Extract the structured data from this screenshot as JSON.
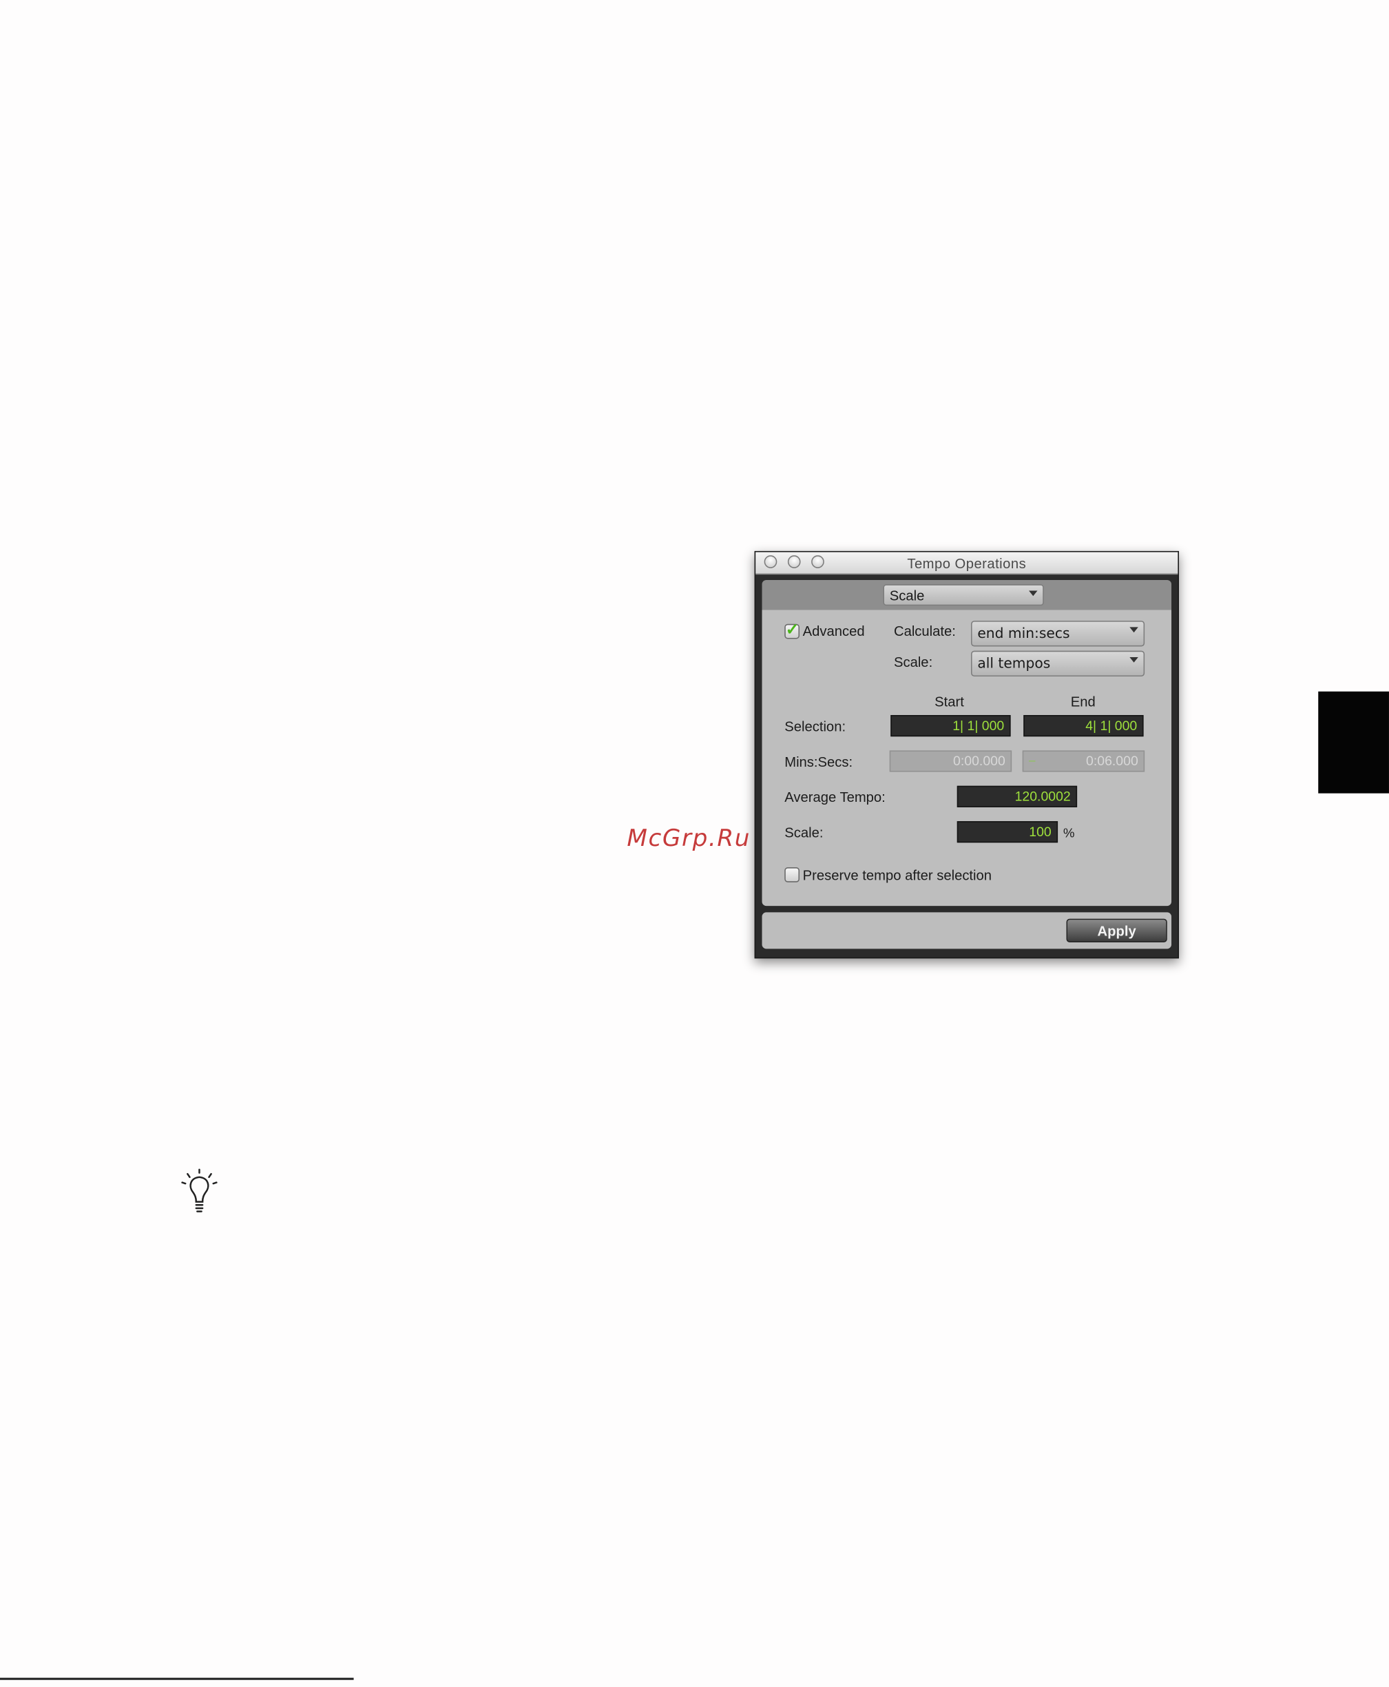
{
  "window": {
    "title": "Tempo Operations",
    "operation_popup": "Scale",
    "advanced_label": "Advanced",
    "advanced_checked": true,
    "calculate_label": "Calculate:",
    "calculate_value": "end min:secs",
    "scale_mode_label": "Scale:",
    "scale_mode_value": "all tempos",
    "col_start": "Start",
    "col_end": "End",
    "selection_label": "Selection:",
    "selection_start": "1| 1| 000",
    "selection_end": "4| 1| 000",
    "minssecs_label": "Mins:Secs:",
    "minssecs_start": "0:00.000",
    "minssecs_end": "0:06.000",
    "avg_tempo_label": "Average Tempo:",
    "avg_tempo_value": "120.0002",
    "scale_label": "Scale:",
    "scale_value": "100",
    "scale_unit": "%",
    "preserve_label": "Preserve tempo after selection",
    "preserve_checked": false,
    "apply_label": "Apply"
  },
  "watermark": "McGrp.Ru",
  "icons": {
    "tip": "lightbulb-icon"
  },
  "colors": {
    "field_text": "#9ee03c",
    "check": "#4bb61a",
    "watermark": "#c63b3b"
  }
}
